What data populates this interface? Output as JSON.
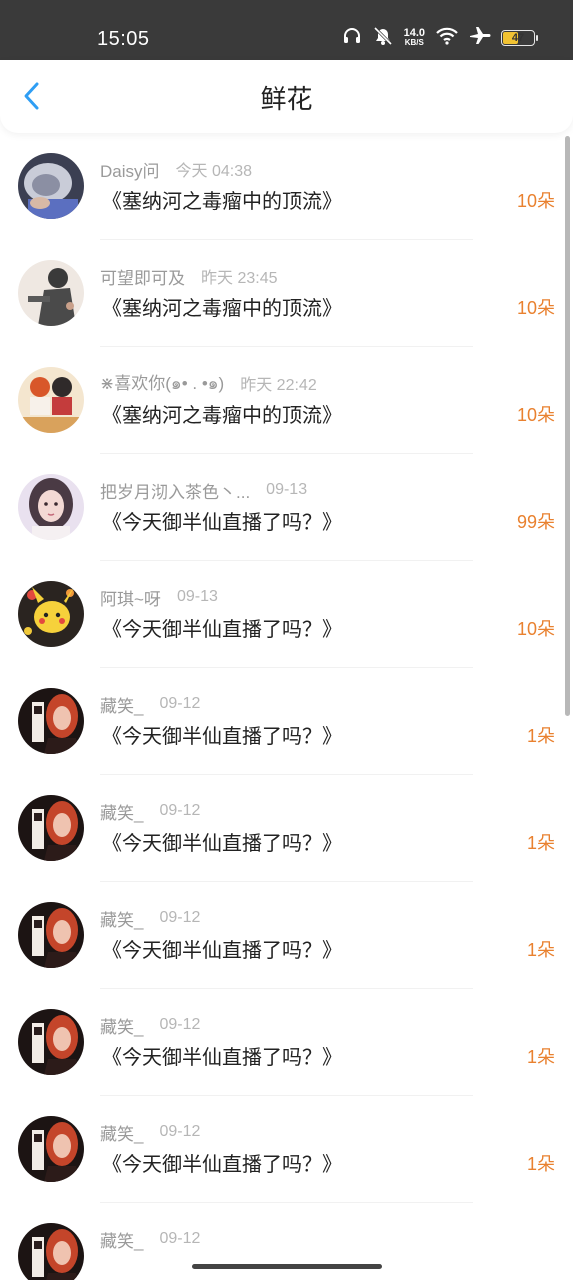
{
  "status_bar": {
    "time": "15:05",
    "net_speed_value": "14.0",
    "net_speed_unit": "KB/S",
    "battery": "47",
    "battery_level": 0.47,
    "icons": [
      "headphones-icon",
      "mute-icon",
      "wifi-icon",
      "airplane-icon",
      "battery-icon"
    ]
  },
  "header": {
    "title": "鲜花",
    "back_icon": "chevron-left-icon",
    "accent": "#2f9ef4"
  },
  "colors": {
    "count": "#e9812f",
    "name": "#9a9a9a",
    "time": "#b6b6b6",
    "book": "#222222"
  },
  "items": [
    {
      "user": "Daisy问",
      "time": "今天 04:38",
      "book": "《塞纳河之毒瘤中的顶流》",
      "count": "10朵",
      "avatar": "avatar-1"
    },
    {
      "user": "可望即可及",
      "time": "昨天 23:45",
      "book": "《塞纳河之毒瘤中的顶流》",
      "count": "10朵",
      "avatar": "avatar-2"
    },
    {
      "user": "⋇喜欢你(๑• . •๑)",
      "time": "昨天 22:42",
      "book": "《塞纳河之毒瘤中的顶流》",
      "count": "10朵",
      "avatar": "avatar-3"
    },
    {
      "user": "把岁月沏入茶色丶...",
      "time": "09-13",
      "book": "《今天御半仙直播了吗？》",
      "count": "99朵",
      "avatar": "avatar-4"
    },
    {
      "user": "阿琪~呀",
      "time": "09-13",
      "book": "《今天御半仙直播了吗？》",
      "count": "10朵",
      "avatar": "avatar-5"
    },
    {
      "user": "藏笑_",
      "time": "09-12",
      "book": "《今天御半仙直播了吗？》",
      "count": "1朵",
      "avatar": "avatar-6"
    },
    {
      "user": "藏笑_",
      "time": "09-12",
      "book": "《今天御半仙直播了吗？》",
      "count": "1朵",
      "avatar": "avatar-6"
    },
    {
      "user": "藏笑_",
      "time": "09-12",
      "book": "《今天御半仙直播了吗？》",
      "count": "1朵",
      "avatar": "avatar-6"
    },
    {
      "user": "藏笑_",
      "time": "09-12",
      "book": "《今天御半仙直播了吗？》",
      "count": "1朵",
      "avatar": "avatar-6"
    },
    {
      "user": "藏笑_",
      "time": "09-12",
      "book": "《今天御半仙直播了吗？》",
      "count": "1朵",
      "avatar": "avatar-6"
    },
    {
      "user": "藏笑_",
      "time": "09-12",
      "book": "",
      "count": "",
      "avatar": "avatar-6"
    }
  ]
}
